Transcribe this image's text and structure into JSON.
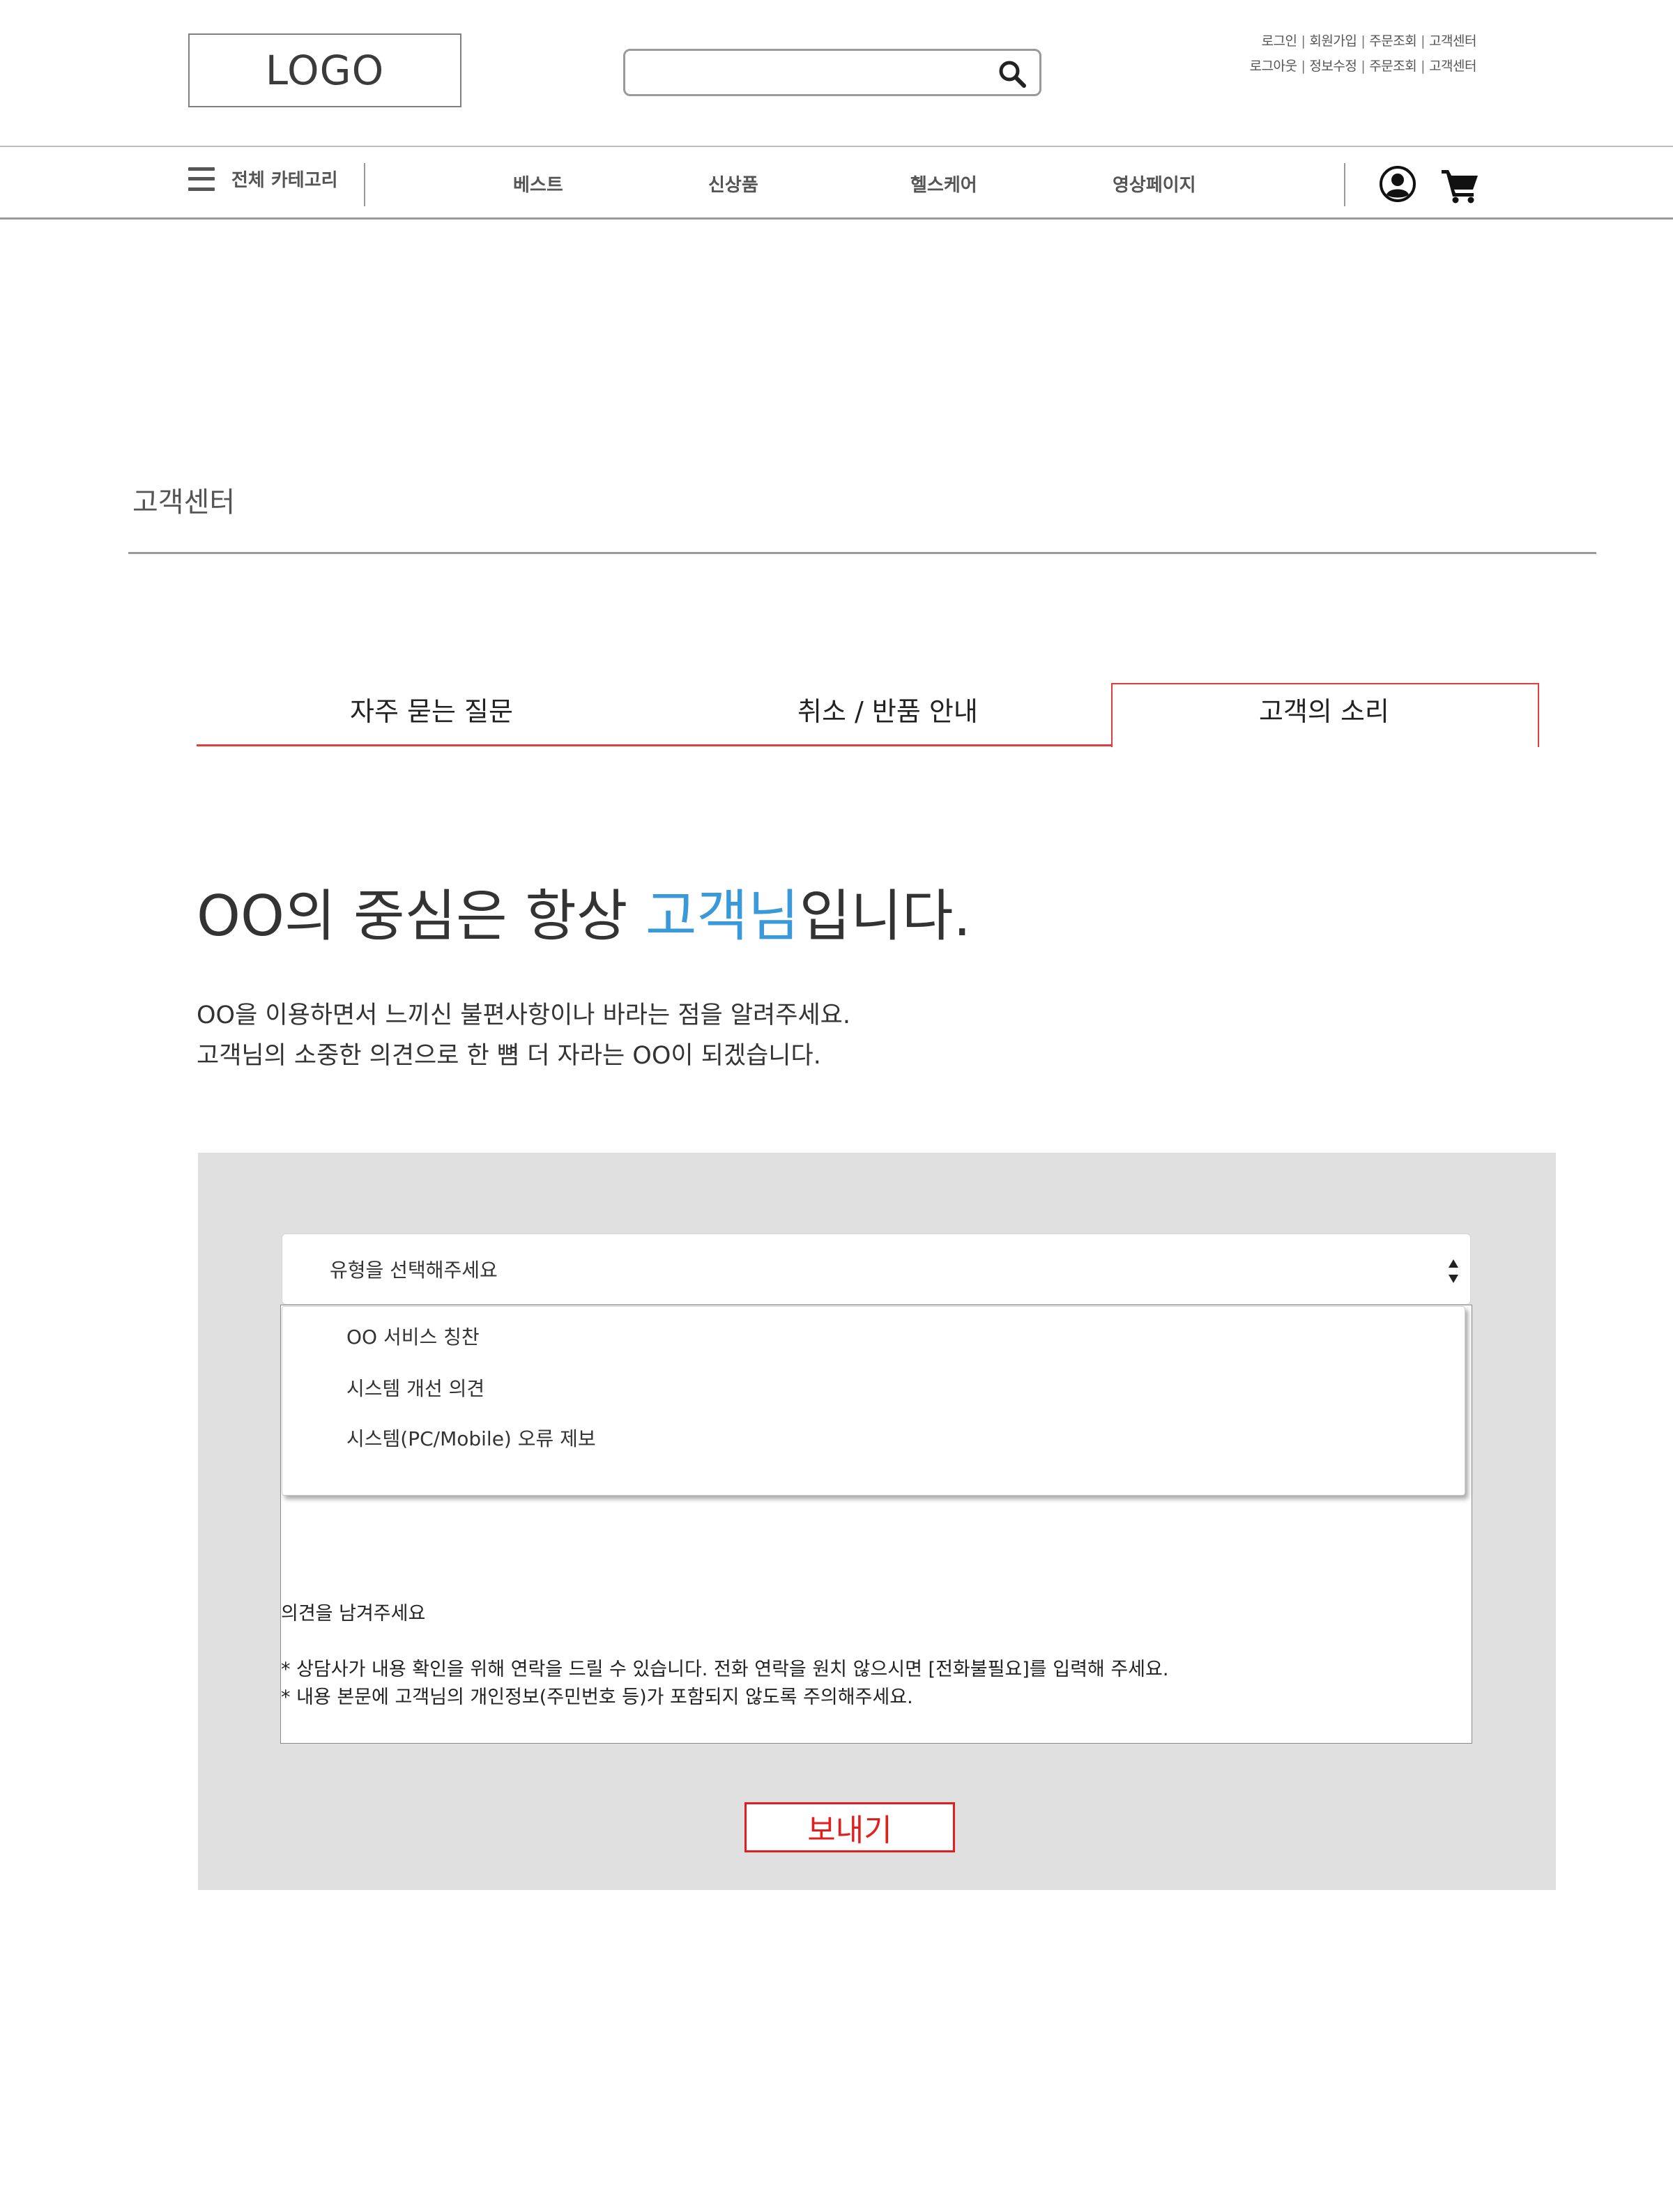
{
  "header": {
    "logo": "LOGO",
    "search": {
      "value": "",
      "placeholder": ""
    },
    "util_links_row1": [
      "로그인",
      "회원가입",
      "주문조회",
      "고객센터"
    ],
    "util_links_row2": [
      "로그아웃",
      "정보수정",
      "주문조회",
      "고객센터"
    ],
    "separator": "|"
  },
  "nav": {
    "all_categories": "전체 카테고리",
    "items": [
      "베스트",
      "신상품",
      "헬스케어",
      "영상페이지"
    ],
    "icons": [
      "menu-icon",
      "user-icon",
      "cart-icon",
      "search-icon"
    ]
  },
  "page": {
    "title": "고객센터",
    "tabs": [
      {
        "label": "자주 묻는 질문",
        "active": false
      },
      {
        "label": "취소 / 반품 안내",
        "active": false
      },
      {
        "label": "고객의 소리",
        "active": true
      }
    ],
    "headline_before": "OO의 중심은 항상 ",
    "headline_highlight": "고객님",
    "headline_after": "입니다.",
    "intro_line1": "OO을 이용하면서 느끼신 불편사항이나 바라는 점을 알려주세요.",
    "intro_line2": "고객님의 소중한 의견으로 한 뼘 더 자라는 OO이 되겠습니다."
  },
  "form": {
    "select_placeholder": "유형을 선택해주세요",
    "options": [
      "OO 서비스 칭찬",
      "시스템 개선 의견",
      "시스템(PC/Mobile) 오류 제보"
    ],
    "textarea_placeholder": "의견을 남겨주세요",
    "note1": "* 상담사가 내용 확인을 위해 연락을 드릴 수 있습니다. 전화 연락을 원치 않으시면 [전화불필요]를 입력해 주세요.",
    "note2": "* 내용 본문에 고객님의 개인정보(주민번호 등)가 포함되지 않도록 주의해주세요.",
    "submit_label": "보내기"
  },
  "colors": {
    "accent_red": "#e43b3b",
    "highlight_blue": "#3a9ad9",
    "panel_gray": "#e0e0e0"
  }
}
